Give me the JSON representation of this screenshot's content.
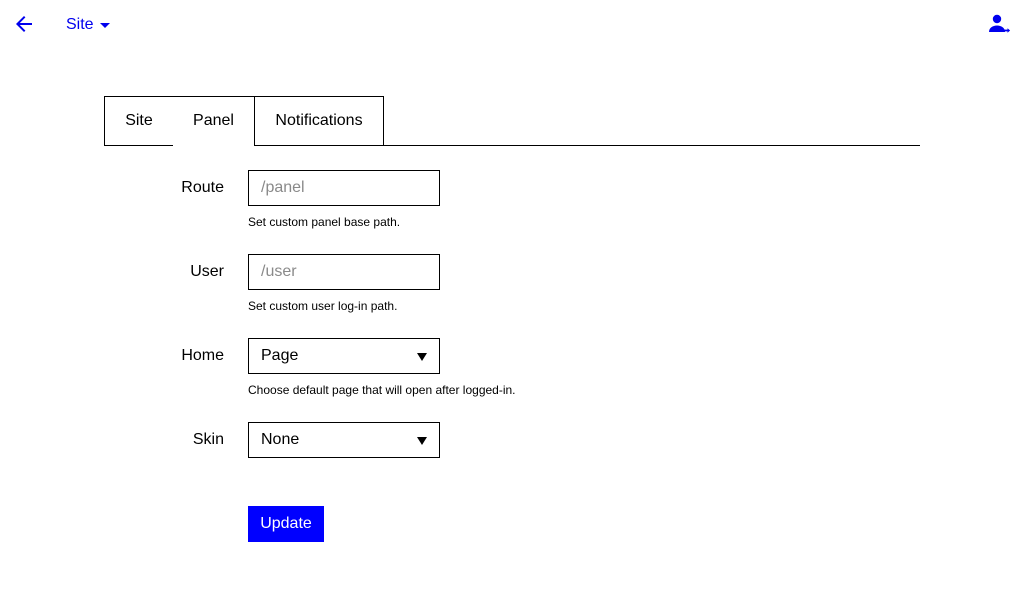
{
  "header": {
    "site_menu_label": "Site",
    "back_icon": "arrow-left-icon",
    "logout_icon": "user-logout-icon",
    "accent_color": "#0000ee"
  },
  "tabs": [
    {
      "label": "Site",
      "active": false
    },
    {
      "label": "Panel",
      "active": true
    },
    {
      "label": "Notifications",
      "active": false
    }
  ],
  "form": {
    "route": {
      "label": "Route",
      "value": "",
      "placeholder": "/panel",
      "help": "Set custom panel base path."
    },
    "user": {
      "label": "User",
      "value": "",
      "placeholder": "/user",
      "help": "Set custom user log-in path."
    },
    "home": {
      "label": "Home",
      "selected": "Page",
      "help": "Choose default page that will open after logged-in."
    },
    "skin": {
      "label": "Skin",
      "selected": "None"
    },
    "submit_label": "Update",
    "button_color": "#0000ff"
  }
}
